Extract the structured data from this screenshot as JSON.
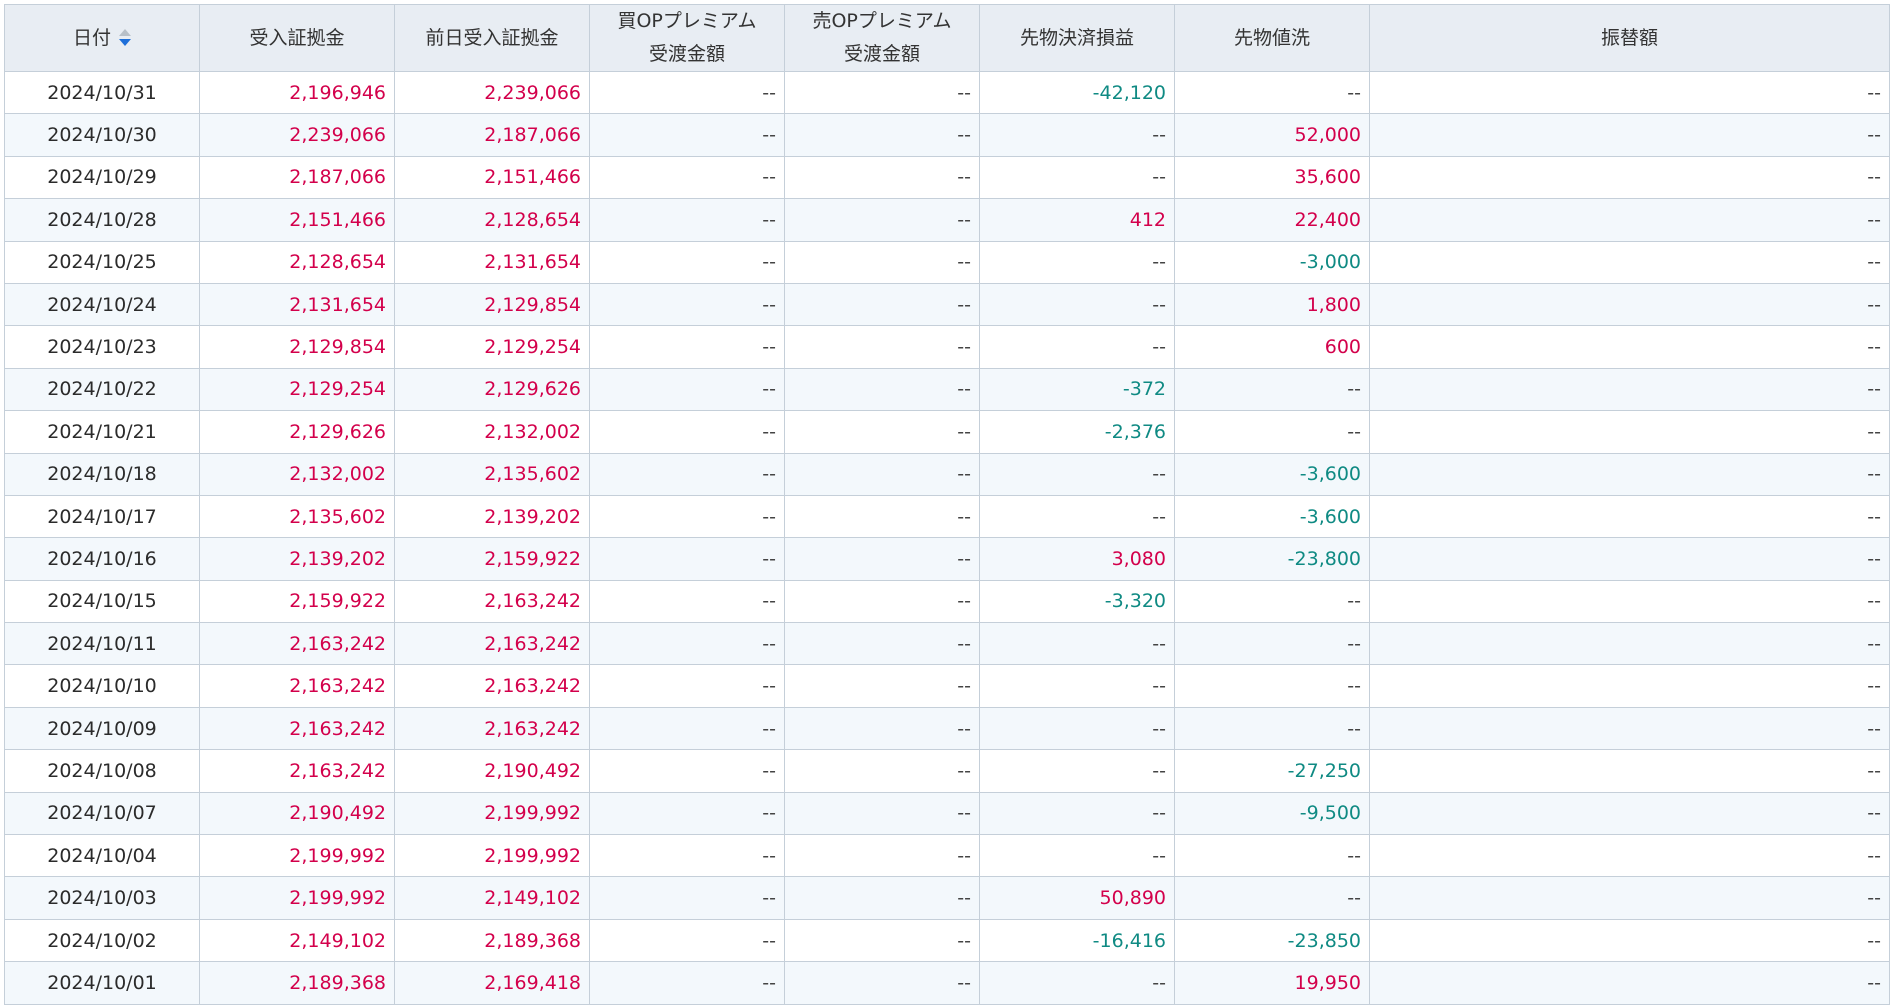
{
  "colors": {
    "positive": "#d3004b",
    "negative": "#0f8a83",
    "header_bg": "#e8edf3",
    "stripe_bg": "#f3f8fc",
    "border": "#c5cfd9"
  },
  "headers": [
    {
      "line1": "日付",
      "line2": "",
      "sort_icon": "sort-desc-icon"
    },
    {
      "line1": "受入証拠金",
      "line2": ""
    },
    {
      "line1": "前日受入証拠金",
      "line2": ""
    },
    {
      "line1": "買OPプレミアム",
      "line2": "受渡金額"
    },
    {
      "line1": "売OPプレミアム",
      "line2": "受渡金額"
    },
    {
      "line1": "先物決済損益",
      "line2": ""
    },
    {
      "line1": "先物値洗",
      "line2": ""
    },
    {
      "line1": "振替額",
      "line2": ""
    }
  ],
  "rows": [
    [
      "2024/10/31",
      "2,196,946",
      "2,239,066",
      "--",
      "--",
      "-42,120",
      "--",
      "--"
    ],
    [
      "2024/10/30",
      "2,239,066",
      "2,187,066",
      "--",
      "--",
      "--",
      "52,000",
      "--"
    ],
    [
      "2024/10/29",
      "2,187,066",
      "2,151,466",
      "--",
      "--",
      "--",
      "35,600",
      "--"
    ],
    [
      "2024/10/28",
      "2,151,466",
      "2,128,654",
      "--",
      "--",
      "412",
      "22,400",
      "--"
    ],
    [
      "2024/10/25",
      "2,128,654",
      "2,131,654",
      "--",
      "--",
      "--",
      "-3,000",
      "--"
    ],
    [
      "2024/10/24",
      "2,131,654",
      "2,129,854",
      "--",
      "--",
      "--",
      "1,800",
      "--"
    ],
    [
      "2024/10/23",
      "2,129,854",
      "2,129,254",
      "--",
      "--",
      "--",
      "600",
      "--"
    ],
    [
      "2024/10/22",
      "2,129,254",
      "2,129,626",
      "--",
      "--",
      "-372",
      "--",
      "--"
    ],
    [
      "2024/10/21",
      "2,129,626",
      "2,132,002",
      "--",
      "--",
      "-2,376",
      "--",
      "--"
    ],
    [
      "2024/10/18",
      "2,132,002",
      "2,135,602",
      "--",
      "--",
      "--",
      "-3,600",
      "--"
    ],
    [
      "2024/10/17",
      "2,135,602",
      "2,139,202",
      "--",
      "--",
      "--",
      "-3,600",
      "--"
    ],
    [
      "2024/10/16",
      "2,139,202",
      "2,159,922",
      "--",
      "--",
      "3,080",
      "-23,800",
      "--"
    ],
    [
      "2024/10/15",
      "2,159,922",
      "2,163,242",
      "--",
      "--",
      "-3,320",
      "--",
      "--"
    ],
    [
      "2024/10/11",
      "2,163,242",
      "2,163,242",
      "--",
      "--",
      "--",
      "--",
      "--"
    ],
    [
      "2024/10/10",
      "2,163,242",
      "2,163,242",
      "--",
      "--",
      "--",
      "--",
      "--"
    ],
    [
      "2024/10/09",
      "2,163,242",
      "2,163,242",
      "--",
      "--",
      "--",
      "--",
      "--"
    ],
    [
      "2024/10/08",
      "2,163,242",
      "2,190,492",
      "--",
      "--",
      "--",
      "-27,250",
      "--"
    ],
    [
      "2024/10/07",
      "2,190,492",
      "2,199,992",
      "--",
      "--",
      "--",
      "-9,500",
      "--"
    ],
    [
      "2024/10/04",
      "2,199,992",
      "2,199,992",
      "--",
      "--",
      "--",
      "--",
      "--"
    ],
    [
      "2024/10/03",
      "2,199,992",
      "2,149,102",
      "--",
      "--",
      "50,890",
      "--",
      "--"
    ],
    [
      "2024/10/02",
      "2,149,102",
      "2,189,368",
      "--",
      "--",
      "-16,416",
      "-23,850",
      "--"
    ],
    [
      "2024/10/01",
      "2,189,368",
      "2,169,418",
      "--",
      "--",
      "--",
      "19,950",
      "--"
    ]
  ]
}
